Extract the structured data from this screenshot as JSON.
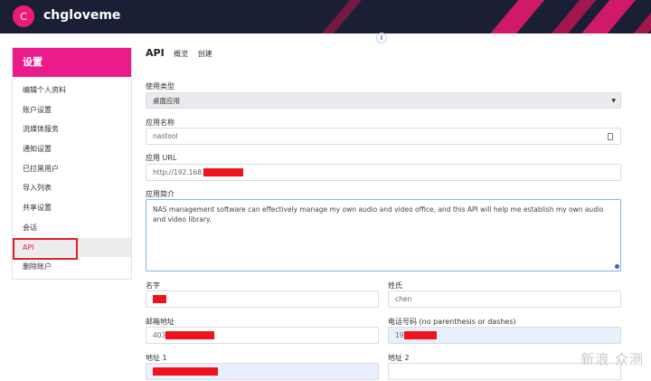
{
  "header": {
    "avatar_letter": "C",
    "username": "chgloveme",
    "info_icon": "i",
    "accent": "#e6196d",
    "background": "#1a1f35"
  },
  "sidebar": {
    "title": "设置",
    "items": [
      {
        "label": "编辑个人资料"
      },
      {
        "label": "账户设置"
      },
      {
        "label": "流媒体服务"
      },
      {
        "label": "通知设置"
      },
      {
        "label": "已拉黑用户"
      },
      {
        "label": "导入列表"
      },
      {
        "label": "共享设置"
      },
      {
        "label": "会话"
      },
      {
        "label": "API"
      },
      {
        "label": "删除账户"
      }
    ],
    "active_item": "API"
  },
  "main": {
    "title": "API",
    "tabs": [
      {
        "label": "概览"
      },
      {
        "label": "创建"
      }
    ]
  },
  "form": {
    "app_type": {
      "label": "使用类型",
      "value": "桌面应用"
    },
    "app_name": {
      "label": "应用名称",
      "value": "nastool"
    },
    "app_url": {
      "label": "应用 URL",
      "value": "http://192.168."
    },
    "app_desc": {
      "label": "应用简介",
      "value": "NAS management software can effectively manage my own audio and video office, and this API will help me establish my own audio and video library."
    },
    "first_name": {
      "label": "名字",
      "value": ""
    },
    "last_name": {
      "label": "姓氏",
      "value": "chen"
    },
    "email": {
      "label": "邮箱地址",
      "value": "403"
    },
    "phone": {
      "label": "电话号码 (no parenthesis or dashes)",
      "value": "19"
    },
    "address1": {
      "label": "地址 1",
      "value": ""
    },
    "address2": {
      "label": "地址 2",
      "value": ""
    }
  },
  "watermark": "新浪 众测",
  "redaction_color": "#ef1320"
}
